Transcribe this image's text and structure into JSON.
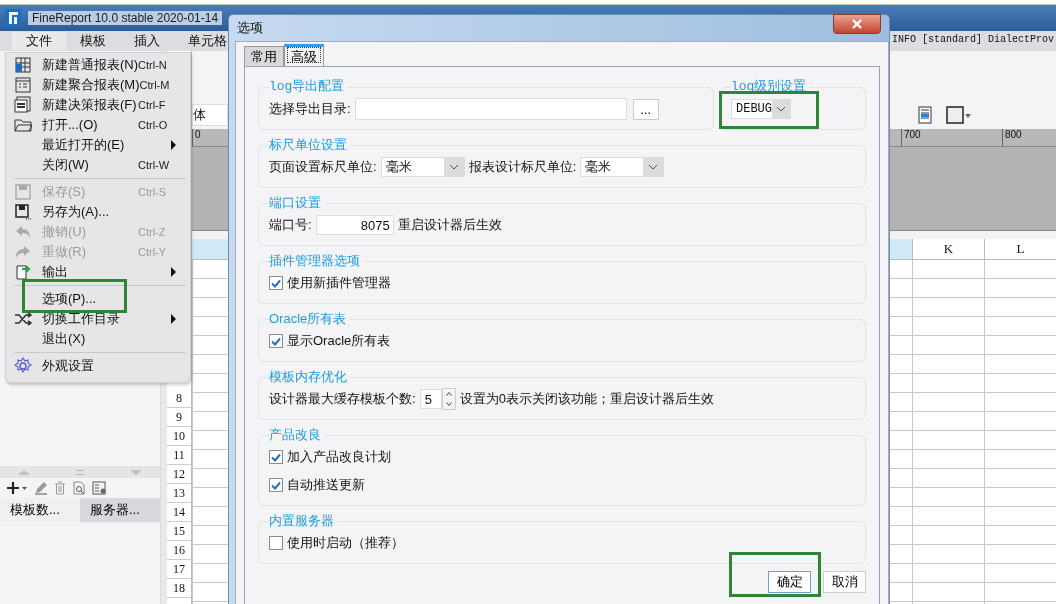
{
  "app": {
    "title": "FineReport 10.0 stable 2020-01-14",
    "menubar": [
      {
        "label": "文件",
        "open": true
      },
      {
        "label": "模板",
        "open": false
      },
      {
        "label": "插入",
        "open": false
      },
      {
        "label": "单元格",
        "open": false
      }
    ],
    "log_line": "INFO [standard] DialectProv",
    "font_field": "体",
    "ruler_labels": [
      "0",
      "700",
      "800"
    ],
    "column_headers": [
      "K",
      "L"
    ],
    "row_numbers": [
      "8",
      "9",
      "10",
      "11",
      "12",
      "13",
      "14",
      "15",
      "16",
      "17",
      "18"
    ],
    "panel_tabs": [
      {
        "label": "模板数...",
        "selected": true
      },
      {
        "label": "服务器...",
        "selected": false
      }
    ]
  },
  "file_menu": {
    "items": [
      {
        "kind": "item",
        "label": "新建普通报表(N)",
        "shortcut": "Ctrl-N",
        "disabled": false
      },
      {
        "kind": "item",
        "label": "新建聚合报表(M)",
        "shortcut": "Ctrl-M",
        "disabled": false
      },
      {
        "kind": "item",
        "label": "新建决策报表(F)",
        "shortcut": "Ctrl-F",
        "disabled": false
      },
      {
        "kind": "item",
        "label": "打开...(O)",
        "shortcut": "Ctrl-O",
        "disabled": false
      },
      {
        "kind": "item",
        "label": "最近打开的(E)",
        "submenu": true,
        "disabled": false
      },
      {
        "kind": "item",
        "label": "关闭(W)",
        "shortcut": "Ctrl-W",
        "disabled": false
      },
      {
        "kind": "separator"
      },
      {
        "kind": "item",
        "label": "保存(S)",
        "shortcut": "Ctrl-S",
        "disabled": true
      },
      {
        "kind": "item",
        "label": "另存为(A)...",
        "disabled": false
      },
      {
        "kind": "item",
        "label": "撤销(U)",
        "shortcut": "Ctrl-Z",
        "disabled": true
      },
      {
        "kind": "item",
        "label": "重做(R)",
        "shortcut": "Ctrl-Y",
        "disabled": true
      },
      {
        "kind": "item",
        "label": "输出",
        "submenu": true,
        "disabled": false
      },
      {
        "kind": "separator"
      },
      {
        "kind": "item",
        "label": "选项(P)...",
        "disabled": false,
        "highlighted": true
      },
      {
        "kind": "item",
        "label": "切换工作目录",
        "submenu": true,
        "disabled": false
      },
      {
        "kind": "item",
        "label": "退出(X)",
        "disabled": false
      },
      {
        "kind": "separator"
      },
      {
        "kind": "item",
        "label": "外观设置",
        "disabled": false
      }
    ]
  },
  "dialog": {
    "title": "选项",
    "tabs": [
      {
        "label": "常用",
        "selected": false
      },
      {
        "label": "高级",
        "selected": true
      }
    ],
    "log_export": {
      "title": "log导出配置",
      "label": "选择导出目录:",
      "browse": "..."
    },
    "log_level": {
      "title": "log级别设置",
      "value": "DEBUG",
      "highlighted": true
    },
    "ruler": {
      "title": "标尺单位设置",
      "page_label": "页面设置标尺单位:",
      "page_value": "毫米",
      "design_label": "报表设计标尺单位:",
      "design_value": "毫米"
    },
    "port": {
      "title": "端口设置",
      "label": "端口号:",
      "value": "8075",
      "note": "重启设计器后生效"
    },
    "sections": [
      {
        "kind": "checks",
        "title": "插件管理器选项",
        "checks": [
          {
            "label": "使用新插件管理器",
            "checked": true
          }
        ]
      },
      {
        "kind": "checks",
        "title": "Oracle所有表",
        "checks": [
          {
            "label": "显示Oracle所有表",
            "checked": true
          }
        ]
      },
      {
        "kind": "spinner",
        "title": "模板内存优化",
        "label": "设计器最大缓存模板个数:",
        "value": "5",
        "note": "设置为0表示关闭该功能；重启设计器后生效"
      },
      {
        "kind": "checks",
        "title": "产品改良",
        "checks": [
          {
            "label": "加入产品改良计划",
            "checked": true
          },
          {
            "label": "自动推送更新",
            "checked": true
          }
        ]
      },
      {
        "kind": "checks",
        "title": "内置服务器",
        "checks": [
          {
            "label": "使用时启动（推荐）",
            "checked": false
          }
        ]
      }
    ],
    "buttons": [
      {
        "label": "确定",
        "highlighted": true
      },
      {
        "label": "取消",
        "highlighted": false
      }
    ]
  }
}
